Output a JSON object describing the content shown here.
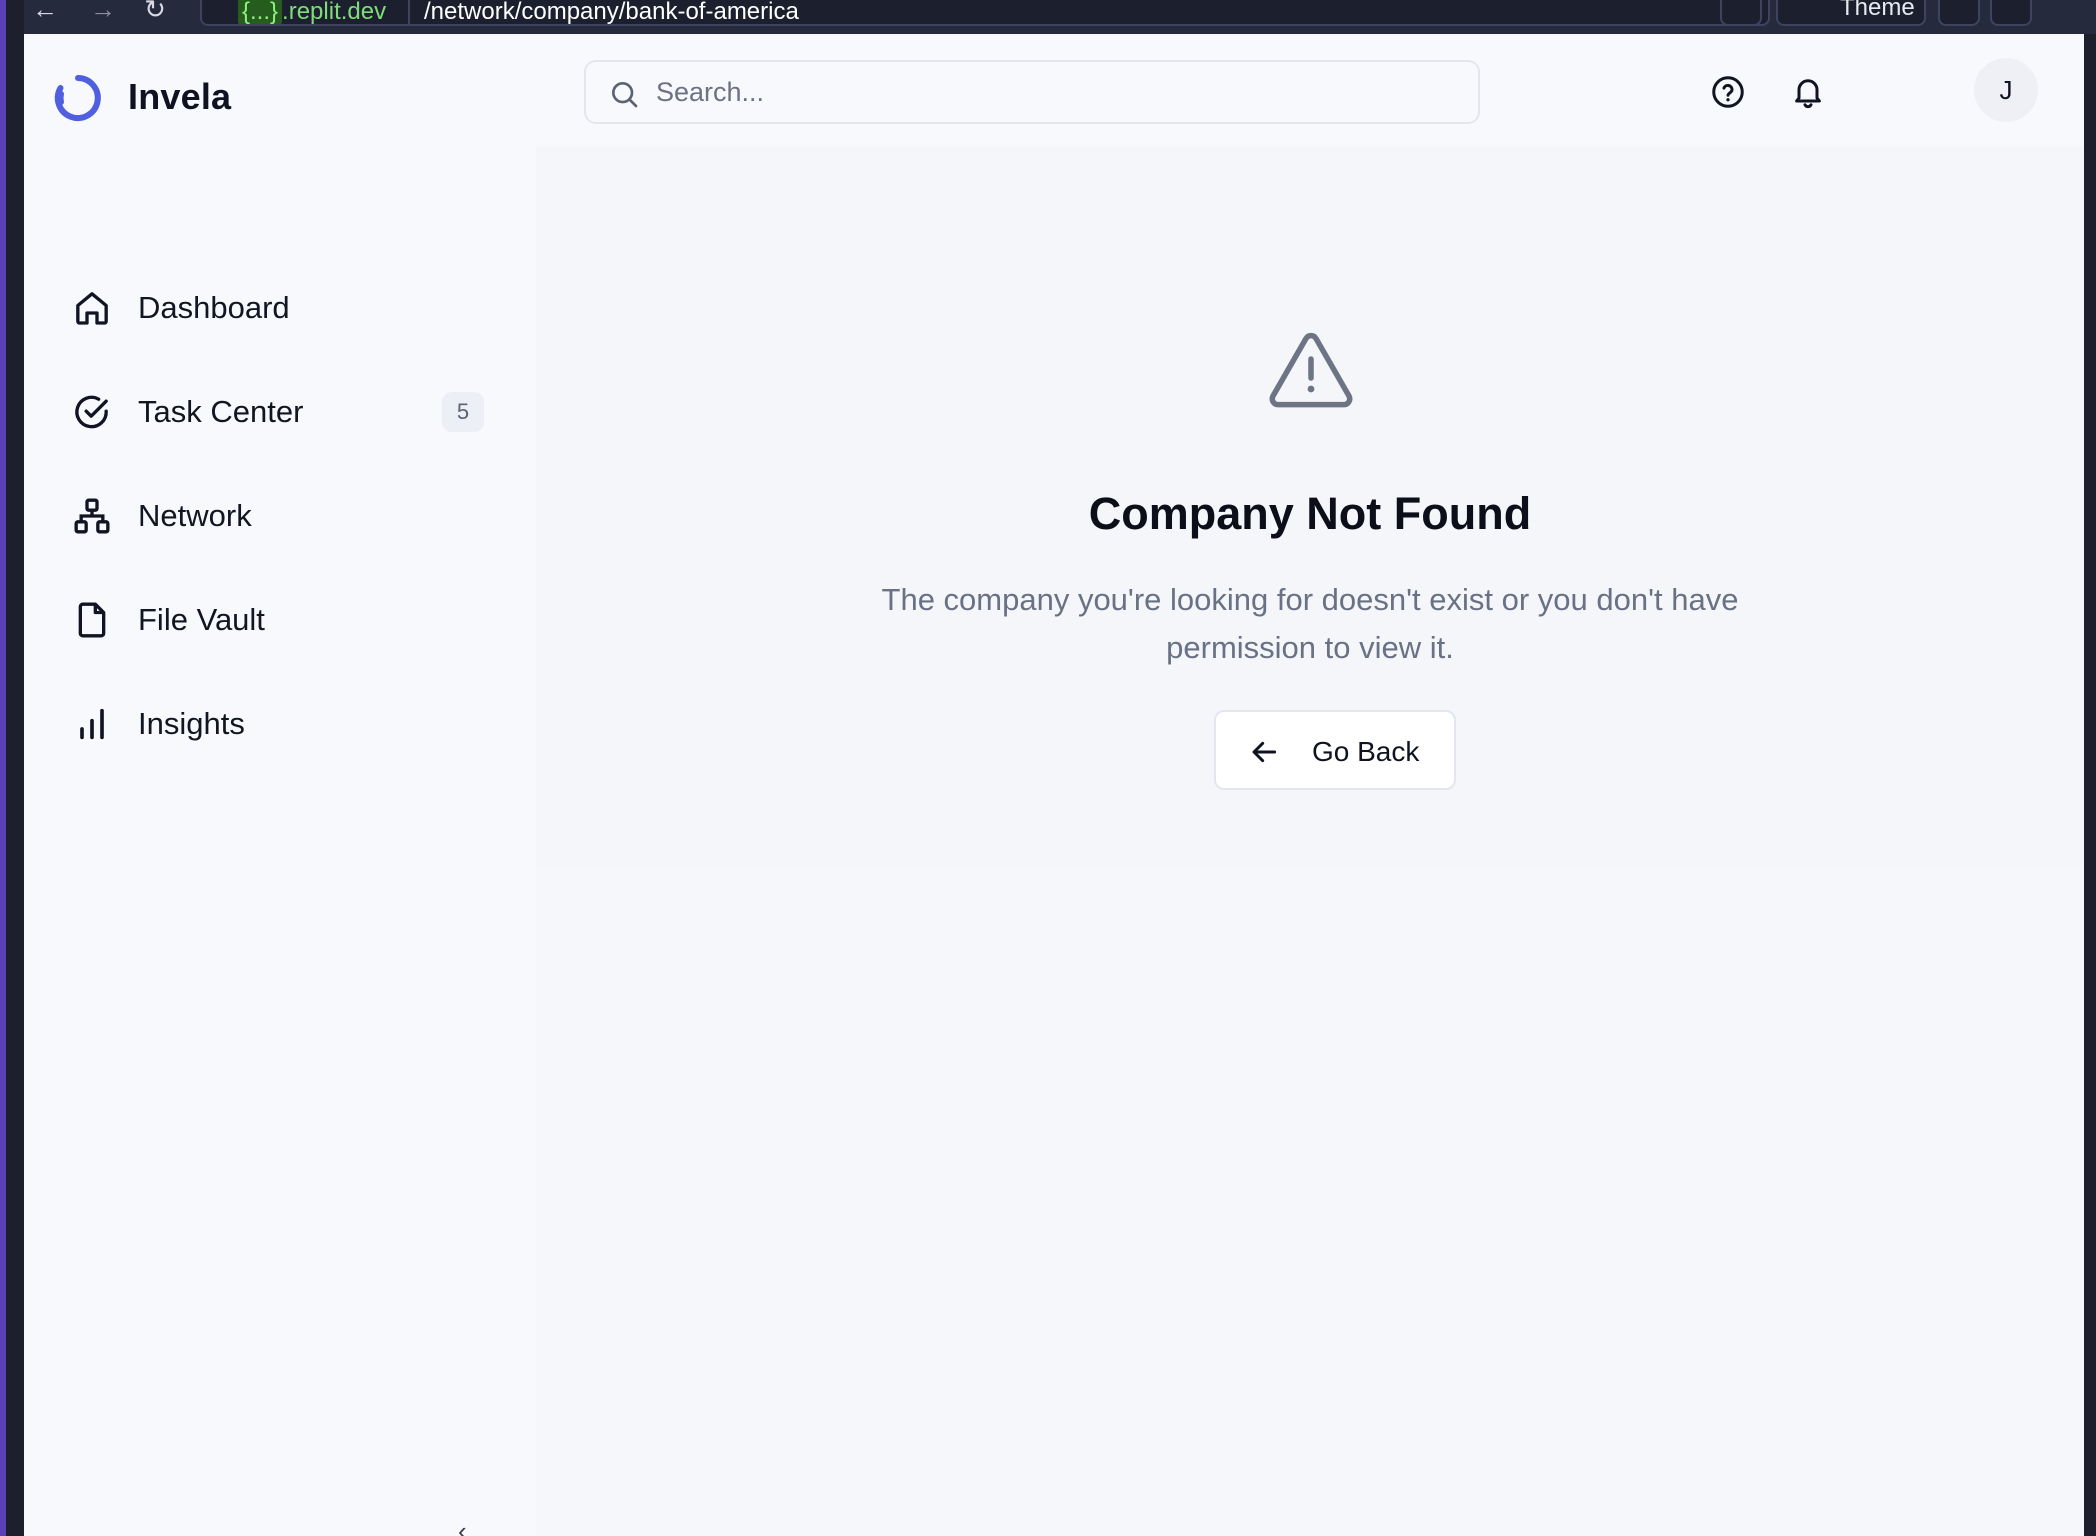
{
  "browser": {
    "url_host_brace": "{...}",
    "url_host_domain": ".replit.dev",
    "url_path": "/network/company/bank-of-america",
    "theme_label": "Theme"
  },
  "app": {
    "brand": "Invela",
    "search": {
      "placeholder": "Search...",
      "value": ""
    },
    "user_initial": "J",
    "accent_color": "#4f5fe0"
  },
  "sidebar": {
    "items": [
      {
        "label": "Dashboard",
        "icon": "home-icon"
      },
      {
        "label": "Task Center",
        "icon": "check-circle-icon",
        "badge": "5"
      },
      {
        "label": "Network",
        "icon": "network-icon"
      },
      {
        "label": "File Vault",
        "icon": "file-icon"
      },
      {
        "label": "Insights",
        "icon": "bar-chart-icon"
      }
    ]
  },
  "main": {
    "title": "Company Not Found",
    "description": "The company you're looking for doesn't exist or you don't have permission to view it.",
    "go_back_label": "Go Back",
    "warning_icon": "alert-triangle-icon"
  }
}
